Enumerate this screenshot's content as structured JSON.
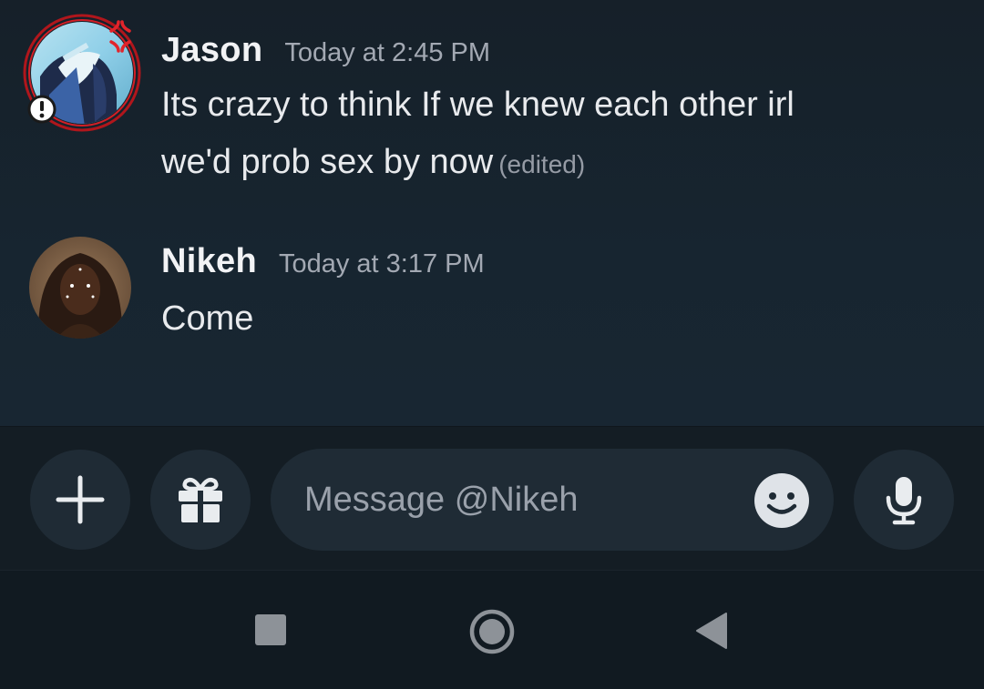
{
  "messages": [
    {
      "username": "Jason",
      "timestamp": "Today at 2:45 PM",
      "lines": [
        "Its crazy to think If we knew each other irl",
        "we'd prob sex by now"
      ],
      "edited": "(edited)"
    },
    {
      "username": "Nikeh",
      "timestamp": "Today at 3:17 PM",
      "lines": [
        "Come"
      ]
    }
  ],
  "composer": {
    "placeholder": "Message @Nikeh",
    "icons": [
      "plus-icon",
      "gift-icon",
      "emoji-icon",
      "microphone-icon"
    ]
  },
  "navbar": {
    "icons": [
      "recents-square-icon",
      "home-circle-icon",
      "back-triangle-icon"
    ]
  },
  "colors": {
    "chat_bg": "#172530",
    "composer_bg": "#141d24",
    "pill_bg": "#1f2b35",
    "text_primary": "#f2f3f5",
    "text_muted": "#a3a9b3"
  }
}
